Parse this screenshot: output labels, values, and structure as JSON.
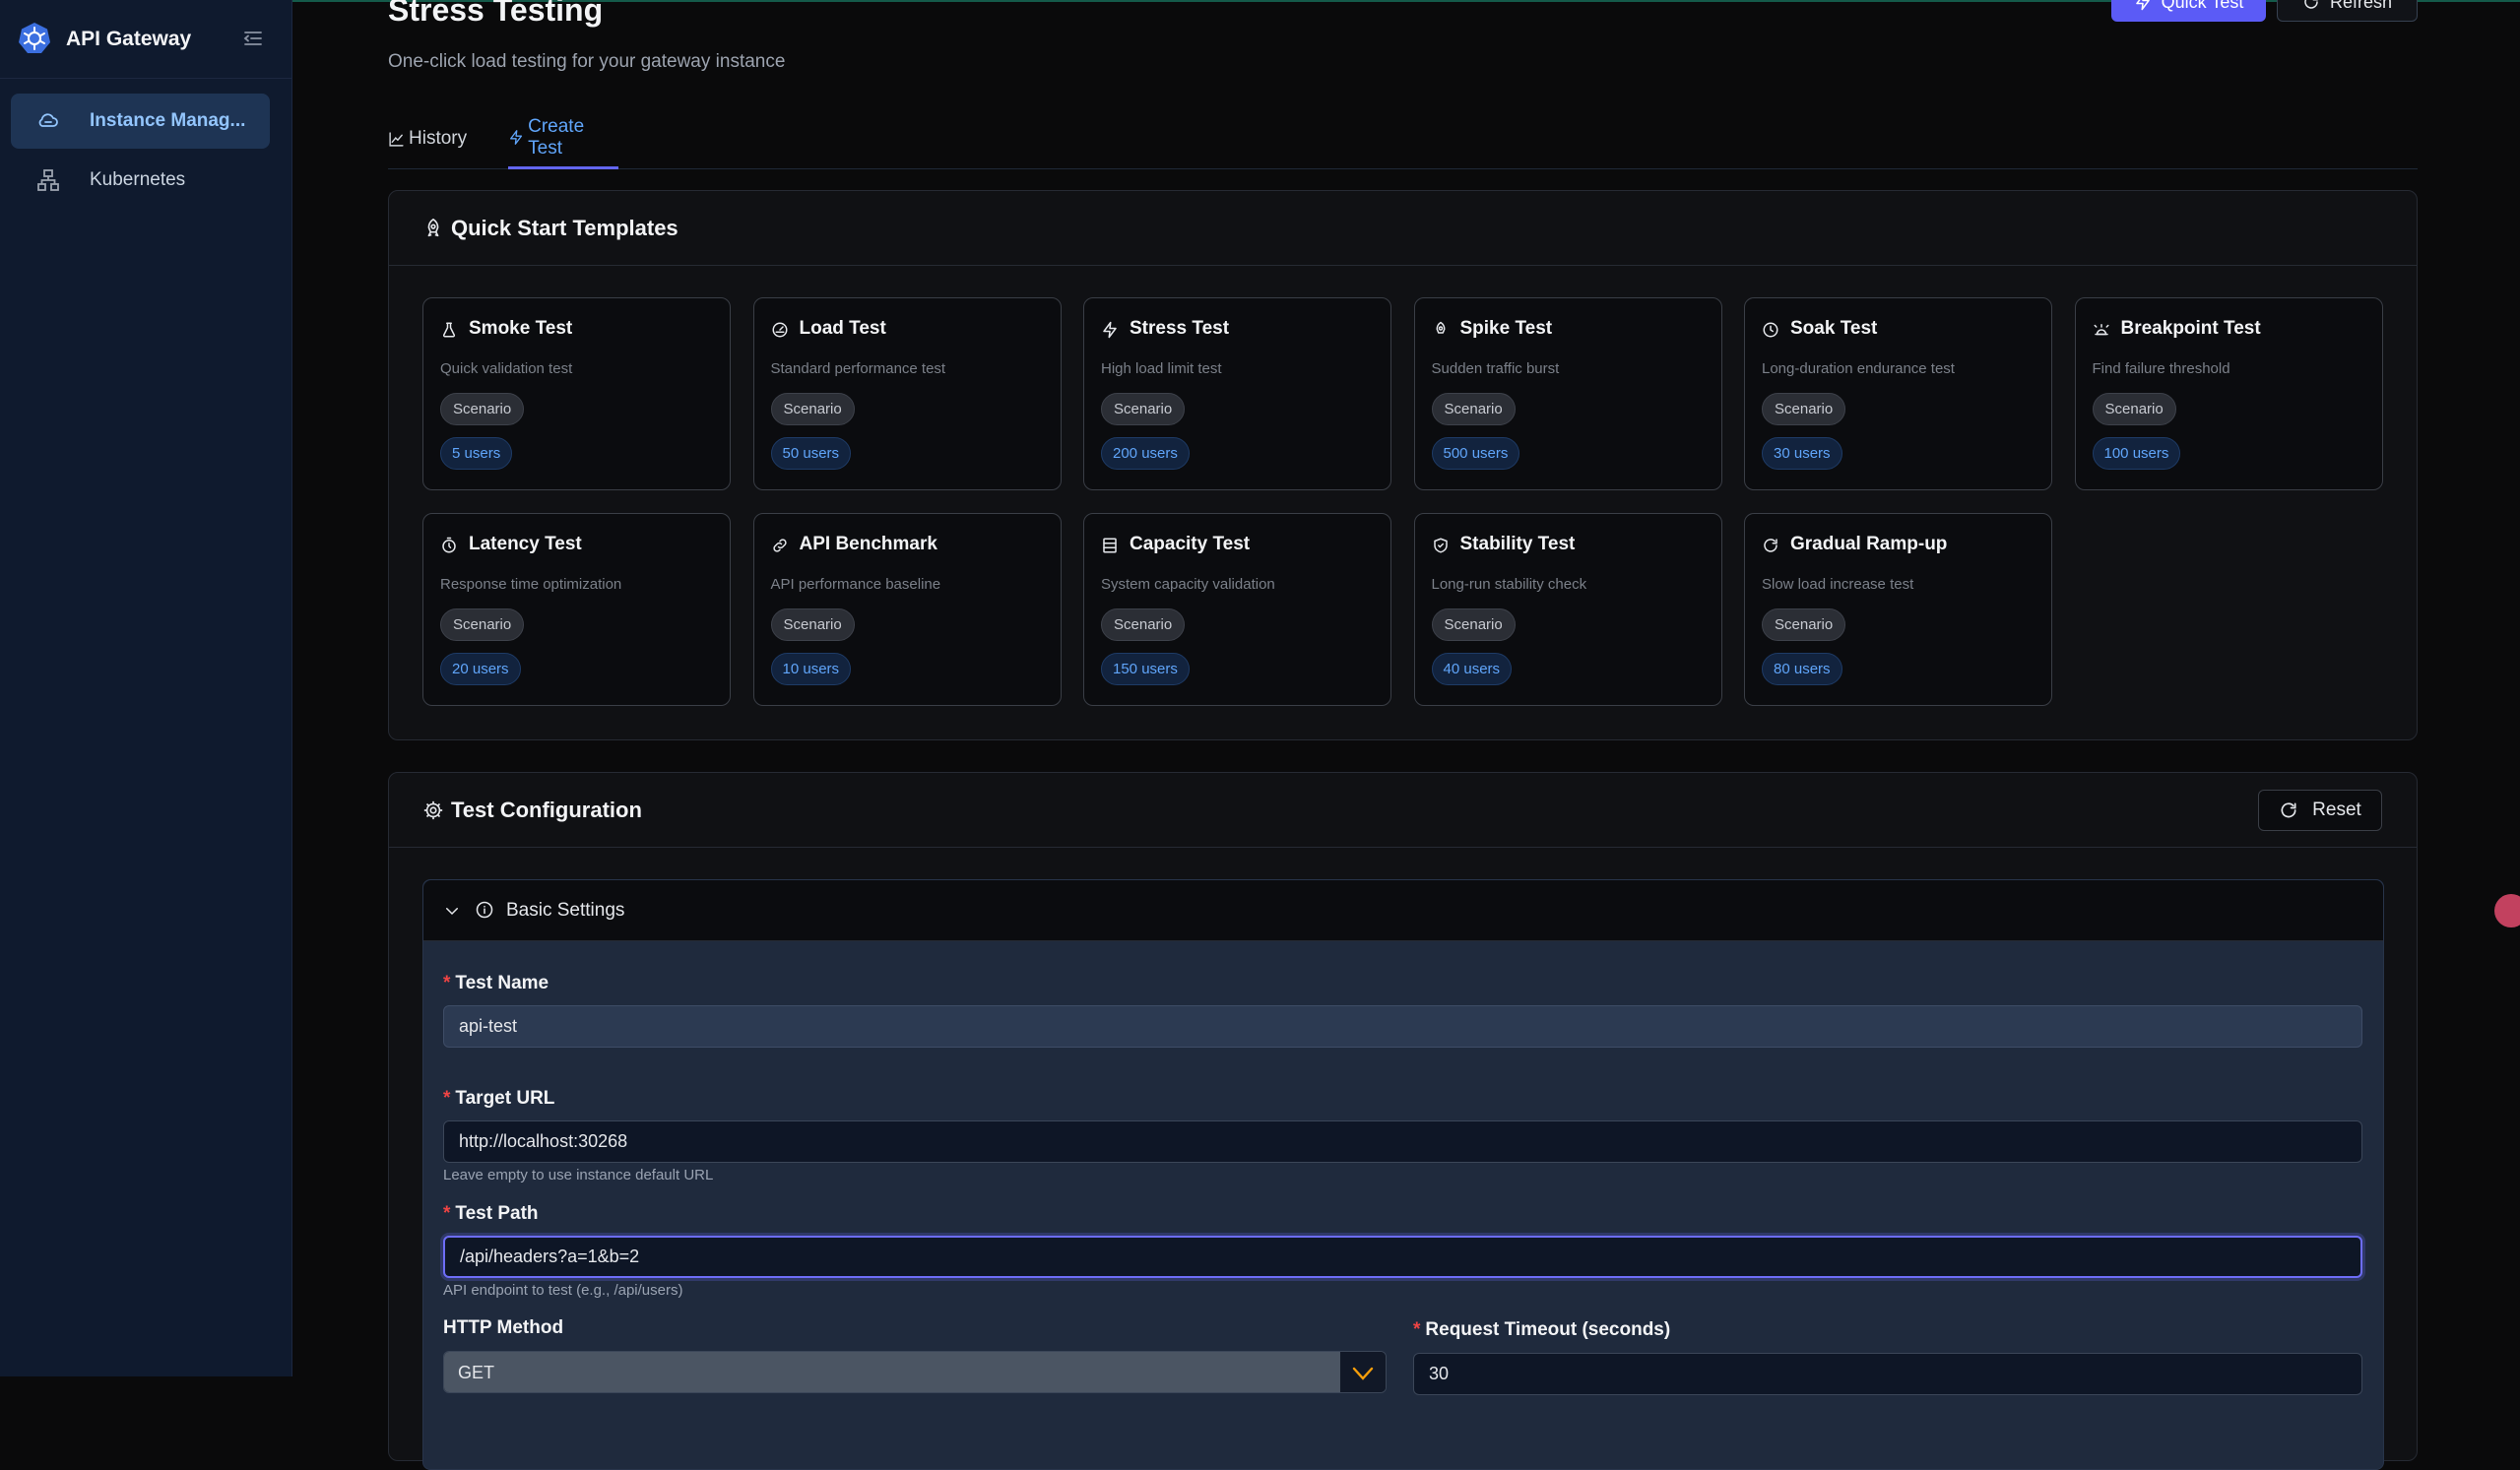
{
  "sidebar": {
    "brand_title": "API Gateway",
    "items": [
      {
        "label": "Instance Manag...",
        "icon": "cloud-icon",
        "active": true
      },
      {
        "label": "Kubernetes",
        "icon": "network-icon",
        "active": false
      }
    ]
  },
  "header": {
    "title": "Stress Testing",
    "subtitle": "One-click load testing for your gateway instance",
    "quick_test_label": "Quick Test",
    "refresh_label": "Refresh"
  },
  "tabs": [
    {
      "label": "History",
      "icon": "line-chart-icon",
      "active": false
    },
    {
      "label": "Create Test",
      "icon": "zap-icon",
      "active": true
    }
  ],
  "templates": {
    "title": "Quick Start Templates",
    "items": [
      {
        "name": "Smoke Test",
        "icon": "flask-icon",
        "desc": "Quick validation test",
        "badge": "Scenario",
        "users": "5 users"
      },
      {
        "name": "Load Test",
        "icon": "gauge-icon",
        "desc": "Standard performance test",
        "badge": "Scenario",
        "users": "50 users"
      },
      {
        "name": "Stress Test",
        "icon": "zap-icon",
        "desc": "High load limit test",
        "badge": "Scenario",
        "users": "200 users"
      },
      {
        "name": "Spike Test",
        "icon": "rocket-icon",
        "desc": "Sudden traffic burst",
        "badge": "Scenario",
        "users": "500 users"
      },
      {
        "name": "Soak Test",
        "icon": "clock-icon",
        "desc": "Long-duration endurance test",
        "badge": "Scenario",
        "users": "30 users"
      },
      {
        "name": "Breakpoint Test",
        "icon": "alarm-icon",
        "desc": "Find failure threshold",
        "badge": "Scenario",
        "users": "100 users"
      },
      {
        "name": "Latency Test",
        "icon": "timer-icon",
        "desc": "Response time optimization",
        "badge": "Scenario",
        "users": "20 users"
      },
      {
        "name": "API Benchmark",
        "icon": "link-icon",
        "desc": "API performance baseline",
        "badge": "Scenario",
        "users": "10 users"
      },
      {
        "name": "Capacity Test",
        "icon": "server-icon",
        "desc": "System capacity validation",
        "badge": "Scenario",
        "users": "150 users"
      },
      {
        "name": "Stability Test",
        "icon": "shield-icon",
        "desc": "Long-run stability check",
        "badge": "Scenario",
        "users": "40 users"
      },
      {
        "name": "Gradual Ramp-up",
        "icon": "refresh-icon",
        "desc": "Slow load increase test",
        "badge": "Scenario",
        "users": "80 users"
      }
    ]
  },
  "config": {
    "title": "Test Configuration",
    "reset_label": "Reset",
    "section_label": "Basic Settings",
    "test_name": {
      "label": "Test Name",
      "value": "api-test"
    },
    "target_url": {
      "label": "Target URL",
      "value": "http://localhost:30268",
      "hint": "Leave empty to use instance default URL"
    },
    "test_path": {
      "label": "Test Path",
      "value": "/api/headers?a=1&b=2",
      "hint": "API endpoint to test (e.g., /api/users)"
    },
    "http_method": {
      "label": "HTTP Method",
      "value": "GET"
    },
    "timeout": {
      "label": "Request Timeout (seconds)",
      "value": "30"
    }
  },
  "colors": {
    "accent": "#6366f1",
    "link": "#60a5fa",
    "required": "#ef4444"
  }
}
